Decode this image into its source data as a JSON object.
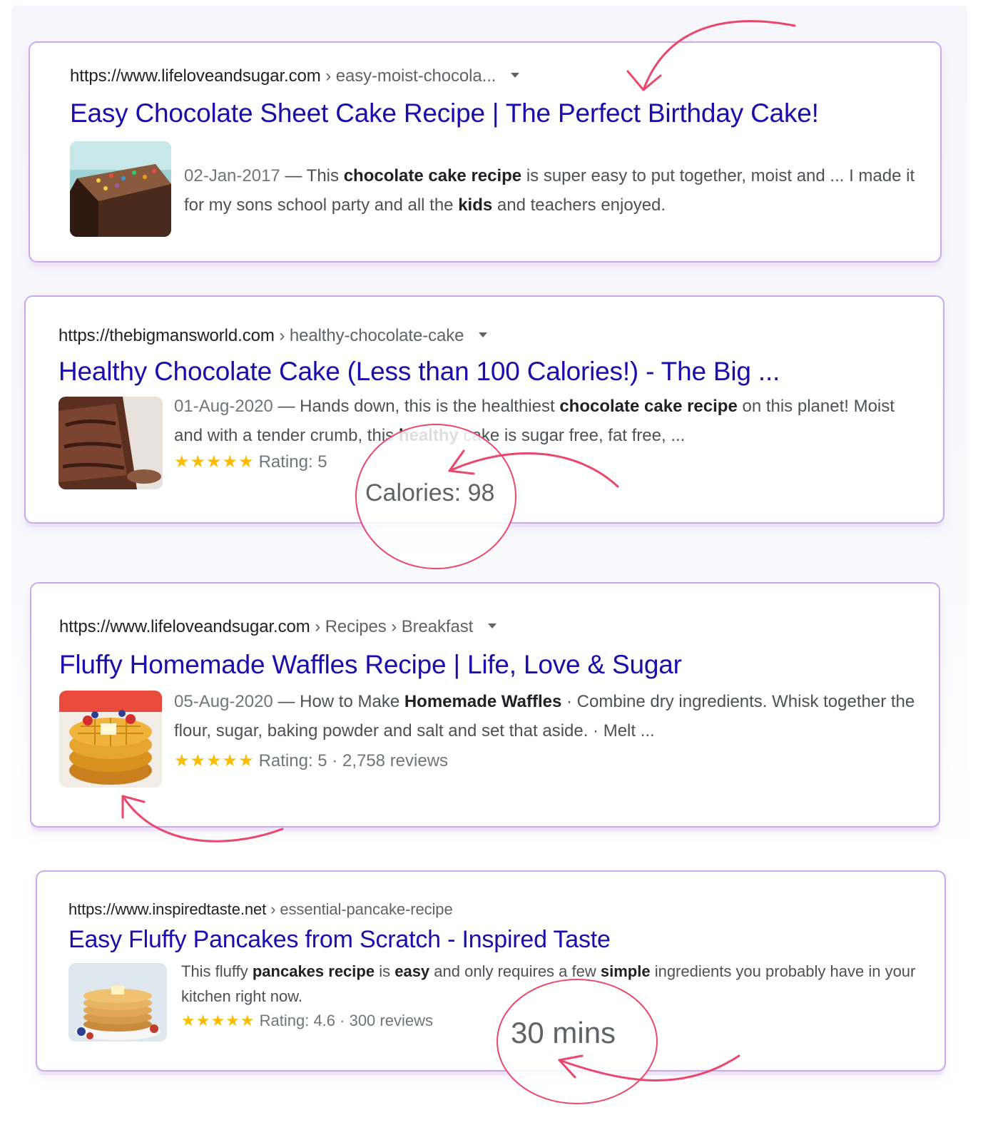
{
  "results": [
    {
      "url_domain": "https://www.lifeloveandsugar.com",
      "url_path": "› easy-moist-chocola...",
      "title": "Easy Chocolate Sheet Cake Recipe | The Perfect Birthday Cake!",
      "image": "chocolate-cake-photo",
      "snippet": {
        "date": "02-Jan-2017",
        "t1": " — This ",
        "b1": "chocolate cake recipe",
        "t2": " is super easy to put together, moist and ... I made it for my sons school party and all the ",
        "b2": "kids",
        "t3": " and teachers enjoyed."
      }
    },
    {
      "url_domain": "https://thebigmansworld.com",
      "url_path": "› healthy-chocolate-cake",
      "title": "Healthy Chocolate Cake (Less than 100 Calories!) - The Big ...",
      "image": "chocolate-cake-slice-photo",
      "snippet": {
        "date": "01-Aug-2020",
        "t1": " — Hands down, this is the healthiest ",
        "b1": "chocolate cake recipe",
        "t2": " on this planet! Moist and with a tender crumb, this ",
        "b2": "healthy",
        "t3": " cake is sugar free, fat free, ..."
      },
      "stars": "★★★★★",
      "rating": "Rating: 5",
      "annotation": "Calories: 98"
    },
    {
      "url_domain": "https://www.lifeloveandsugar.com",
      "url_path": "› Recipes › Breakfast",
      "title": "Fluffy Homemade Waffles Recipe | Life, Love & Sugar",
      "image": "waffles-photo",
      "snippet": {
        "date": "05-Aug-2020",
        "t1": " — How to Make ",
        "b1": "Homemade Waffles",
        "t2": " · Combine dry ingredients. Whisk together the flour, sugar, baking powder and salt and set that aside. · Melt ..."
      },
      "stars": "★★★★★",
      "rating": "Rating: 5 · 2,758 reviews"
    },
    {
      "url_domain": "https://www.inspiredtaste.net",
      "url_path": "› essential-pancake-recipe",
      "title": "Easy Fluffy Pancakes from Scratch - Inspired Taste",
      "image": "pancakes-photo",
      "snippet": {
        "t1": "This fluffy ",
        "b1": "pancakes recipe",
        "t2": " is ",
        "b2": "easy",
        "t3": " and only requires a few ",
        "b3": "simple",
        "t4": " ingredients you probably have in your kitchen right now."
      },
      "stars": "★★★★★",
      "rating": "Rating: 4.6 · 300 reviews",
      "annotation": "30 mins"
    }
  ],
  "colors": {
    "link": "#1a0dab",
    "card_border": "#c9a8ee",
    "annotation": "#e9476b",
    "star": "#fbbc04"
  }
}
